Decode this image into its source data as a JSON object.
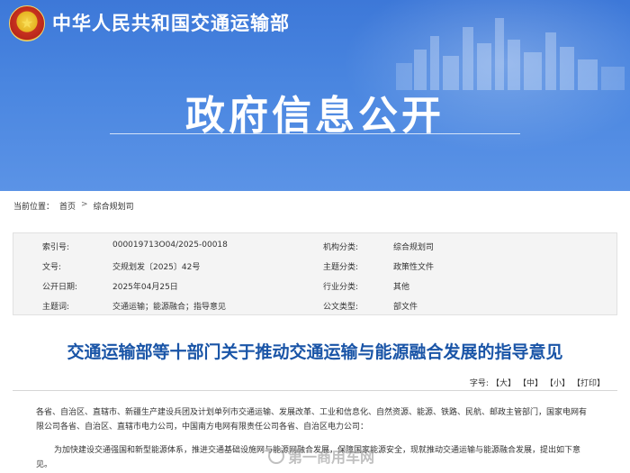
{
  "header": {
    "ministry_name": "中华人民共和国交通运输部",
    "section_title": "政府信息公开"
  },
  "breadcrumb": {
    "label": "当前位置：",
    "items": [
      "首页",
      "综合规划司"
    ],
    "separator": ">"
  },
  "meta": {
    "rows": [
      {
        "k1": "索引号:",
        "v1": "000019713O04/2025-00018",
        "k2": "机构分类:",
        "v2": "综合规划司"
      },
      {
        "k1": "文号:",
        "v1": "交规划发〔2025〕42号",
        "k2": "主题分类:",
        "v2": "政策性文件"
      },
      {
        "k1": "公开日期:",
        "v1": "2025年04月25日",
        "k2": "行业分类:",
        "v2": "其他"
      },
      {
        "k1": "主题词:",
        "v1": "交通运输；能源融合；指导意见",
        "k2": "公文类型:",
        "v2": "部文件"
      }
    ]
  },
  "document": {
    "title": "交通运输部等十部门关于推动交通运输与能源融合发展的指导意见",
    "paragraph1": "各省、自治区、直辖市、新疆生产建设兵团及计划单列市交通运输、发展改革、工业和信息化、自然资源、能源、铁路、民航、邮政主管部门，国家电网有限公司各省、自治区、直辖市电力公司，中国南方电网有限责任公司各省、自治区电力公司：",
    "paragraph2": "为加快建设交通强国和新型能源体系，推进交通基础设施网与能源网融合发展，保障国家能源安全，现就推动交通运输与能源融合发展，提出如下意见。"
  },
  "font_controls": {
    "label": "字号:",
    "large": "【大】",
    "medium": "【中】",
    "small": "【小】",
    "print": "【打印】"
  },
  "watermark": {
    "text": "第一商用车网"
  },
  "colors": {
    "banner": "#4a86e0",
    "title_blue": "#1a55a7",
    "meta_bg": "#f4f4f4"
  }
}
